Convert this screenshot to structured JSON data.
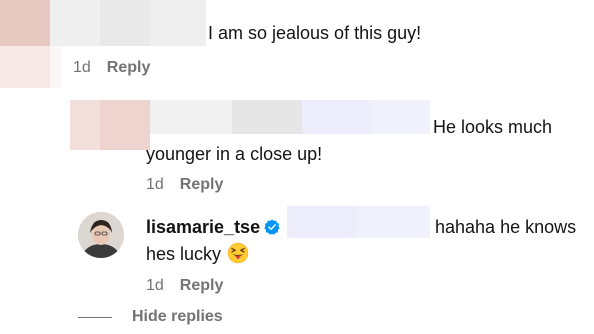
{
  "comments": [
    {
      "text": "I am so jealous of this guy!",
      "time": "1d",
      "reply_label": "Reply"
    },
    {
      "text_line1": "He looks much",
      "text_line2": "younger in a close up!",
      "time": "1d",
      "reply_label": "Reply"
    },
    {
      "username": "lisamarie_tse",
      "verified": true,
      "text_line1": "hahaha he knows",
      "text_line2": "hes lucky",
      "emoji": "squinting-face-with-tongue",
      "time": "1d",
      "reply_label": "Reply"
    }
  ],
  "hide_replies_label": "Hide replies",
  "colors": {
    "text": "#141414",
    "meta": "#737373",
    "verified": "#0095f6",
    "redaction_pink": "#ecd5d0",
    "redaction_lavender": "#ecebfb"
  }
}
